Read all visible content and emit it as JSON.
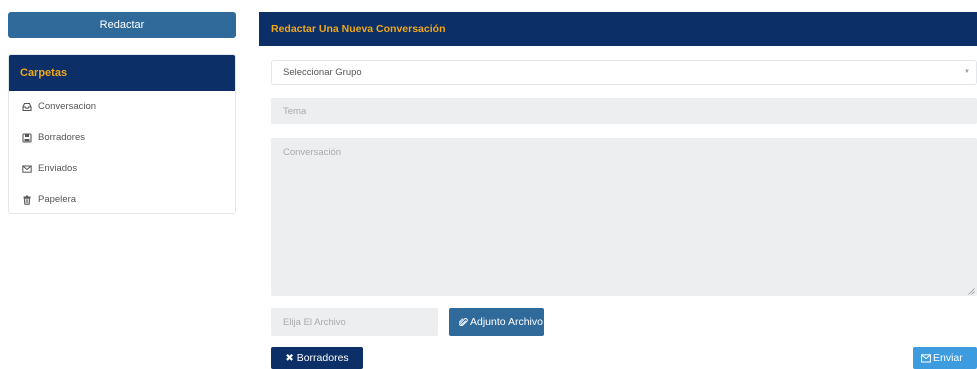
{
  "sidebar": {
    "compose_label": "Redactar",
    "folders_title": "Carpetas",
    "items": [
      {
        "label": "Conversacion",
        "icon": "inbox-icon"
      },
      {
        "label": "Borradores",
        "icon": "save-icon"
      },
      {
        "label": "Enviados",
        "icon": "envelope-icon"
      },
      {
        "label": "Papelera",
        "icon": "trash-icon"
      }
    ]
  },
  "main": {
    "title": "Redactar Una Nueva Conversación",
    "group_select": {
      "value": "Seleccionar Grupo"
    },
    "subject": {
      "placeholder": "Tema"
    },
    "message": {
      "placeholder": "Conversación"
    },
    "file_input": {
      "placeholder": "Elija El Archivo"
    },
    "attach_label": "Adjunto Archivo",
    "drafts_label": "Borradores",
    "send_label": "Enviar"
  },
  "colors": {
    "header_bg": "#0b2f66",
    "header_text": "#f0a818",
    "primary_button": "#2f6a9b",
    "send_button": "#3d9ce0",
    "input_bg": "#eceeef"
  }
}
